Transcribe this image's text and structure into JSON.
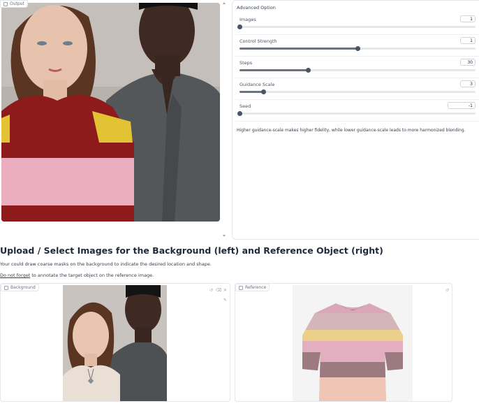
{
  "output": {
    "label": "Output",
    "label_icon": "image-icon",
    "image_alt": "Woman in red, pink and yellow striped sweater beside man in grey shirt"
  },
  "advanced": {
    "title": "Advanced Option",
    "sliders": [
      {
        "label": "Images",
        "value": "1",
        "fraction": 0.0
      },
      {
        "label": "Control Strength",
        "value": "1",
        "fraction": 0.5
      },
      {
        "label": "Steps",
        "value": "30",
        "fraction": 0.29
      },
      {
        "label": "Guidance Scale",
        "value": "3",
        "fraction": 0.1
      },
      {
        "label": "Seed",
        "value": "-1",
        "fraction": 0.0
      }
    ],
    "hint": "Higher guidance-scale makes higher fidelity, while lower guidance-scale leads to more harmonized blending."
  },
  "section": {
    "heading": "Upload / Select Images for the Background (left) and Reference Object (right)",
    "instruction_1": "Your could draw coarse masks on the background to indicate the desired location and shape.",
    "instruction_2_emph": "Do not forget",
    "instruction_2_rest": " to annotate the target object on the reference image."
  },
  "background": {
    "label": "Background",
    "label_icon": "image-icon",
    "tools": [
      "undo-icon",
      "clear-icon",
      "close-icon",
      "brush-icon"
    ]
  },
  "reference": {
    "label": "Reference",
    "label_icon": "image-icon",
    "tools": [
      "undo-icon"
    ]
  },
  "colors": {
    "slider_fill": "#6b7280",
    "border": "#e5e7eb"
  }
}
